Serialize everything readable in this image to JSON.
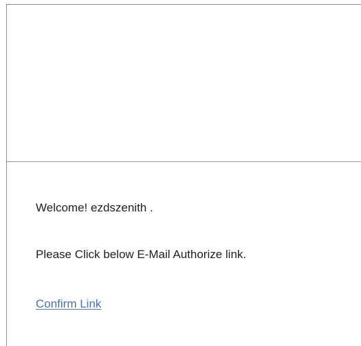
{
  "email": {
    "greeting": "Welcome! ezdszenith .",
    "instruction": "Please Click below E-Mail Authorize link.",
    "confirm_link_label": "Confirm Link"
  },
  "colors": {
    "link": "#4a6fb5",
    "text": "#1f1f1f",
    "border": "#8a8a8a"
  }
}
